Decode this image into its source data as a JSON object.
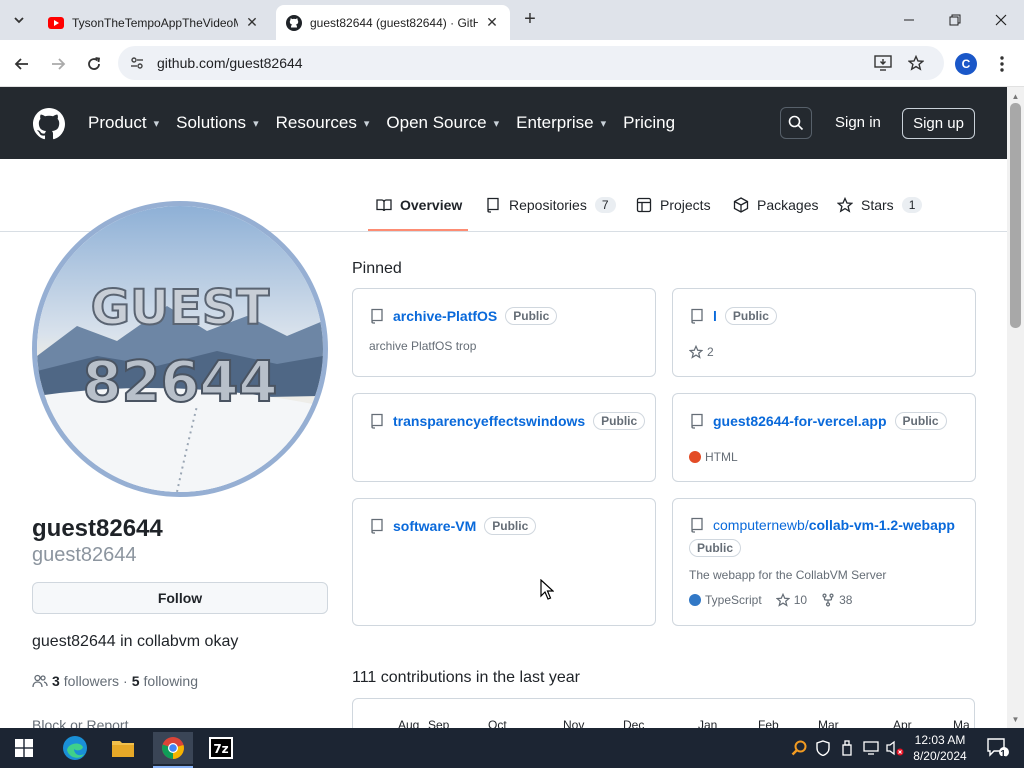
{
  "browser": {
    "tabs": [
      {
        "title": "TysonTheTempoAppTheVideoM"
      },
      {
        "title": "guest82644 (guest82644) · GitHub"
      }
    ],
    "url": "github.com/guest82644",
    "profile_initial": "C"
  },
  "gh_header": {
    "nav": [
      {
        "label": "Product"
      },
      {
        "label": "Solutions"
      },
      {
        "label": "Resources"
      },
      {
        "label": "Open Source"
      },
      {
        "label": "Enterprise"
      },
      {
        "label": "Pricing"
      }
    ],
    "sign_in": "Sign in",
    "sign_up": "Sign up"
  },
  "profile_tabs": [
    {
      "label": "Overview"
    },
    {
      "label": "Repositories",
      "count": "7"
    },
    {
      "label": "Projects"
    },
    {
      "label": "Packages"
    },
    {
      "label": "Stars",
      "count": "1"
    }
  ],
  "profile": {
    "avatar_text_line1": "GUEST",
    "avatar_text_line2": "82644",
    "name": "guest82644",
    "handle": "guest82644",
    "follow": "Follow",
    "bio": "guest82644 in collabvm okay",
    "followers_count": "3",
    "followers_label": "followers",
    "separator": "·",
    "following_count": "5",
    "following_label": "following",
    "block_report": "Block or Report"
  },
  "pinned": {
    "title": "Pinned",
    "repos": [
      {
        "name": "archive-PlatfOS",
        "visibility": "Public",
        "description": "archive PlatfOS trop"
      },
      {
        "name": "l",
        "visibility": "Public",
        "stars": "2"
      },
      {
        "name": "transparencyeffectswindows",
        "visibility": "Public"
      },
      {
        "name": "guest82644-for-vercel.app",
        "visibility": "Public",
        "language": "HTML",
        "language_color": "#e34c26"
      },
      {
        "name": "software-VM",
        "visibility": "Public"
      },
      {
        "owner": "computernewb/",
        "name": "collab-vm-1.2-webapp",
        "visibility": "Public",
        "description": "The webapp for the CollabVM Server",
        "language": "TypeScript",
        "language_color": "#3178c6",
        "stars": "10",
        "forks": "38"
      }
    ]
  },
  "contributions": {
    "title": "111 contributions in the last year",
    "months": [
      "Aug",
      "Sep",
      "Oct",
      "Nov",
      "Dec",
      "Jan",
      "Feb",
      "Mar",
      "Apr",
      "Ma"
    ]
  },
  "taskbar": {
    "time": "12:03 AM",
    "date": "8/20/2024",
    "notification_count": "1"
  }
}
